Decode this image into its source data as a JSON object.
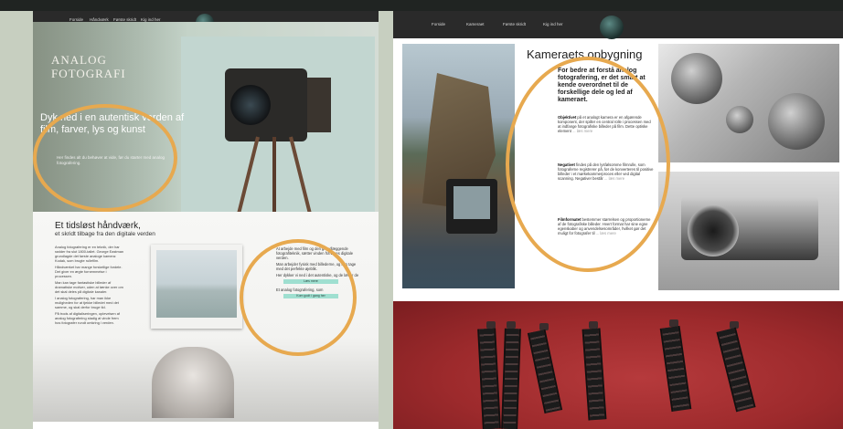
{
  "left_page": {
    "nav": [
      "Forside",
      "Håndværk",
      "Første skridt",
      "Kig ind her"
    ],
    "hero": {
      "title": "ANALOG\nFOTOGRAFI",
      "subtitle": "Dyk ned i en autentisk verden af film, farver, lys og kunst",
      "small": "Her findes alt du behøver at vide, før du starter med analog fotografering."
    },
    "section": {
      "title": "Et tidsløst håndværk,",
      "subtitle": "et skridt tilbage fra den digitale verden",
      "left_paragraphs": [
        "Analog fotografering er en teknik, der har rødder fra slut 1800-tallet. George Eastman grundlagde det første analoge kamera: Kodak, som brugte rullefilm.",
        "Håndværket har mange forskellige fordele. Det giver en ægte fornemmelse i processen.",
        "Man kan tage fantastiske billeder af dramatiske motiver, uden at tænke over om det skal deles på digitale kanaler.",
        "I analog fotografering, har man ikke muligheden for at tjekke billedet med det samme, og skal derfor bruge tid.",
        "På trods af digitaliseringen, oplevelsen af analog fotografering stadig at vinde frem hos fotografer rundt omkring i verden."
      ],
      "right_paragraphs": [
        "At arbejde med film og den grundlæggende fotografiteknik, sætter vinden fra deres digitale verden.",
        "Man arbejder fysisk med billederne, og kan tage med det perfekte øjeblik.",
        "Her dykker vi ned i det autentiske, og de læser de"
      ],
      "pill1": "Læs mere",
      "right_text2": "Et analog fotografering, som",
      "pill2": "Kom godt i gang her"
    }
  },
  "right_page": {
    "nav": [
      "Forside",
      "Kameraet",
      "Første skridt",
      "Kig ind her"
    ],
    "title": "Kameraets opbygning",
    "intro": "For bedre at forstå analog fotografering, er det smart at kende overordnet til de forskellige dele og led af kameraet.",
    "blocks": [
      {
        "term": "Objektivet",
        "text": "på et analogt kamera er en afgørende komponent, der spiller en central rolle i processen med at indfange fotografiske billeder på film. Dette optiske element",
        "more": "... læs mere"
      },
      {
        "term": "Negativet",
        "text": "findes på den lysfølsomme filmrulle, som fotograferne registrerer på, før de konverteres til positive billeder i et mørkekammerproces eller ved digital scanning. Negativer består",
        "more": "... læs mere"
      },
      {
        "term": "Filmformatet",
        "text": "bestemmer størrelsen og proportionerne af de fotografiske billeder. Hvert format har sine egne egenskaber og anvendelsesområder, hvilket gør det muligt for fotografer til",
        "more": "... læs mere"
      }
    ]
  },
  "colors": {
    "highlight_ring": "#e7a94f",
    "nav_bg": "#2a2a2a",
    "red_band": "#b63a3c",
    "mint_pill": "#9fdfd0"
  }
}
